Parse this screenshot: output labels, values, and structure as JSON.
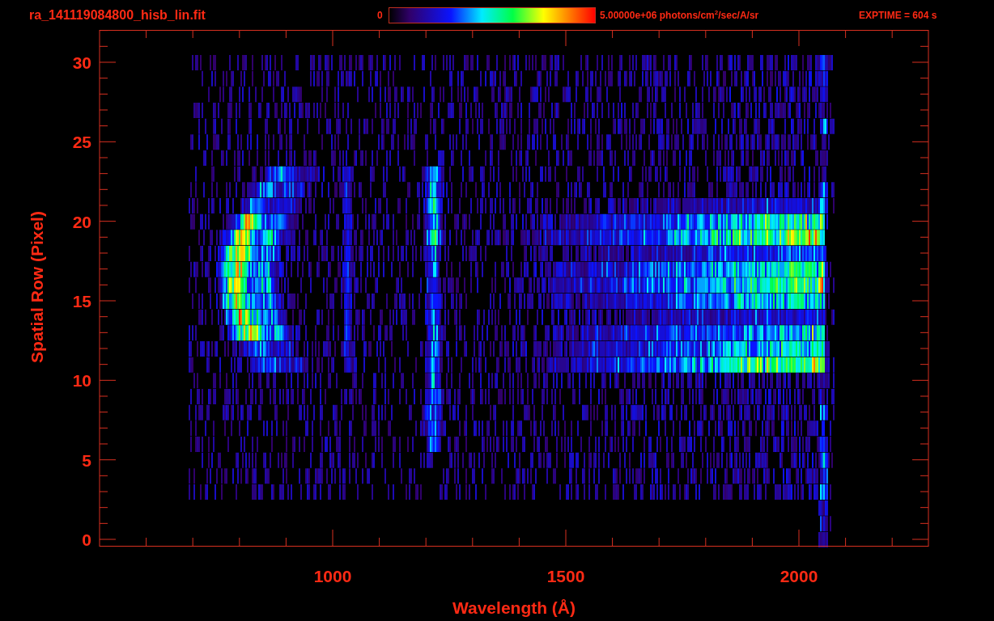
{
  "title": "ra_141119084800_hisb_lin.fit",
  "colorbar": {
    "min_label": "0",
    "max_label": "5.00000e+06 photons/cm$^{2}$/sec/A/sr"
  },
  "exptime": "EXPTIME = 604 s",
  "plot": {
    "xlabel": "Wavelength (Å)",
    "ylabel": "Spatial Row (Pixel)",
    "xticks": [
      "1000",
      "1500",
      "2000"
    ],
    "yticks": [
      "30",
      "25",
      "20",
      "15",
      "10",
      "5",
      "0"
    ]
  }
}
